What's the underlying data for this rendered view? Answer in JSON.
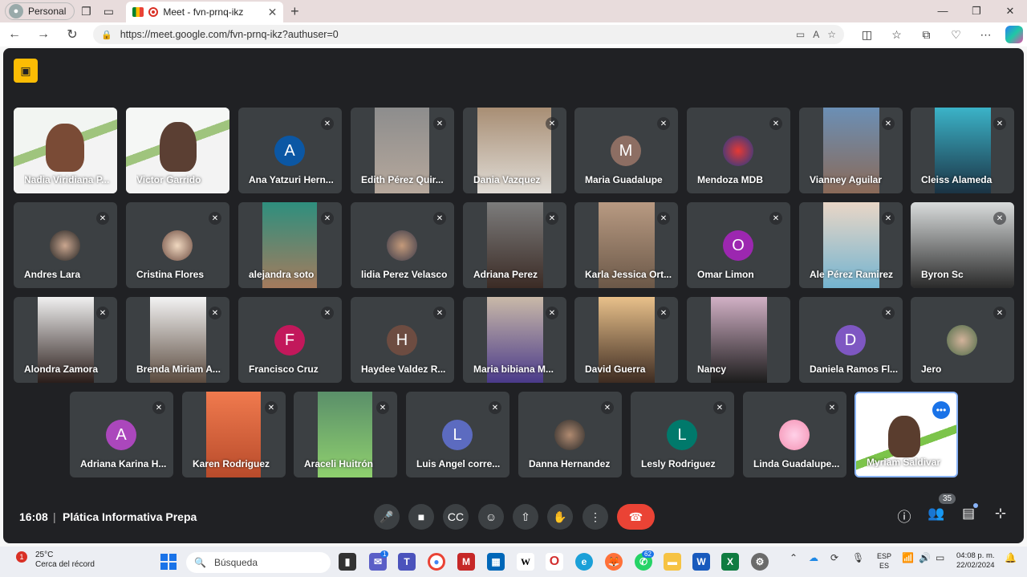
{
  "browser": {
    "profile_label": "Personal",
    "tab_title": "Meet - fvn-prnq-ikz",
    "url": "https://meet.google.com/fvn-prnq-ikz?authuser=0"
  },
  "meet": {
    "clock": "16:08",
    "divider": "|",
    "meeting_title": "Plática Informativa Prepa",
    "people_count": "35",
    "participants_row1": [
      "Nadia Viridiana P...",
      "Victor Garrido",
      "Ana Yatzuri Hern...",
      "Edith Pérez Quir...",
      "Dania Vazquez",
      "Maria Guadalupe",
      "Mendoza MDB",
      "Vianney Aguilar",
      "Cleiss Alameda"
    ],
    "participants_row2": [
      "Andres Lara",
      "Cristina Flores",
      "alejandra soto",
      "lidia Perez Velasco",
      "Adriana Perez",
      "Karla Jessica Ort...",
      "Omar Limon",
      "Ale Pérez Ramirez",
      "Byron Sc"
    ],
    "participants_row3": [
      "Alondra Zamora",
      "Brenda Miriam A...",
      "Francisco Cruz",
      "Haydee Valdez R...",
      "Maria bibiana M...",
      "David Guerra",
      "Nancy",
      "Daniela Ramos Fl...",
      "Jero"
    ],
    "participants_row4": [
      "Adriana Karina H...",
      "Karen Rodriguez",
      "Araceli Huitrón",
      "Luis Angel corre...",
      "Danna Hernandez",
      "Lesly Rodriguez",
      "Linda Guadalupe...",
      "Myriam Saldivar"
    ],
    "avatar_letters": {
      "ana": "A",
      "maria": "M",
      "omar": "O",
      "francisco": "F",
      "haydee": "H",
      "daniela": "D",
      "adriana_karina": "A",
      "luis": "L",
      "lesly": "L"
    },
    "avatar_colors": {
      "ana": "#0b57a4",
      "maria": "#8d6e63",
      "omar": "#9c27b0",
      "francisco": "#c2185b",
      "haydee": "#6d4c41",
      "daniela": "#7e57c2",
      "adriana_karina": "#ab47bc",
      "luis": "#5c6bc0",
      "lesly": "#00796b"
    }
  },
  "taskbar": {
    "temp": "25°C",
    "weather_text": "Cerca del récord",
    "weather_badge": "1",
    "search_placeholder": "Búsqueda",
    "lang_top": "ESP",
    "lang_bottom": "ES",
    "time": "04:08 p. m.",
    "date": "22/02/2024",
    "teams_badge": "1",
    "whatsapp_badge": "62"
  }
}
